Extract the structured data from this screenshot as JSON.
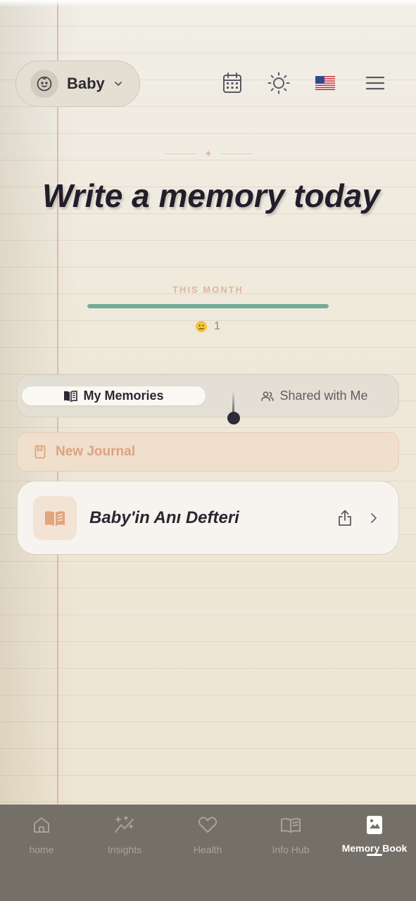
{
  "header": {
    "child_name": "Baby",
    "icons": [
      "baby-face-icon",
      "chevron-down-icon",
      "calendar-icon",
      "sun-icon",
      "us-flag-icon",
      "menu-icon"
    ]
  },
  "hero": {
    "title": "Write a memory today",
    "month_label": "THIS MONTH",
    "month_progress": 1.0,
    "month_count": "1",
    "progress_color": "#73ac96"
  },
  "tabs": {
    "my_memories": "My Memories",
    "shared_with_me": "Shared with Me",
    "active": "my_memories"
  },
  "new_journal": {
    "label": "New Journal"
  },
  "journals": [
    {
      "title": "Baby'in Anı Defteri"
    }
  ],
  "bottom_nav": {
    "items": [
      {
        "label": "home",
        "icon": "home-icon"
      },
      {
        "label": "Insights",
        "icon": "sparkles-chart-icon"
      },
      {
        "label": "Health",
        "icon": "heart-icon"
      },
      {
        "label": "Info Hub",
        "icon": "open-book-icon"
      },
      {
        "label": "Memory Book",
        "icon": "photo-bookmark-icon",
        "active": true
      }
    ]
  },
  "colors": {
    "accent": "#dfa27a",
    "nav_bg": "#747068",
    "title": "#221d2a"
  }
}
